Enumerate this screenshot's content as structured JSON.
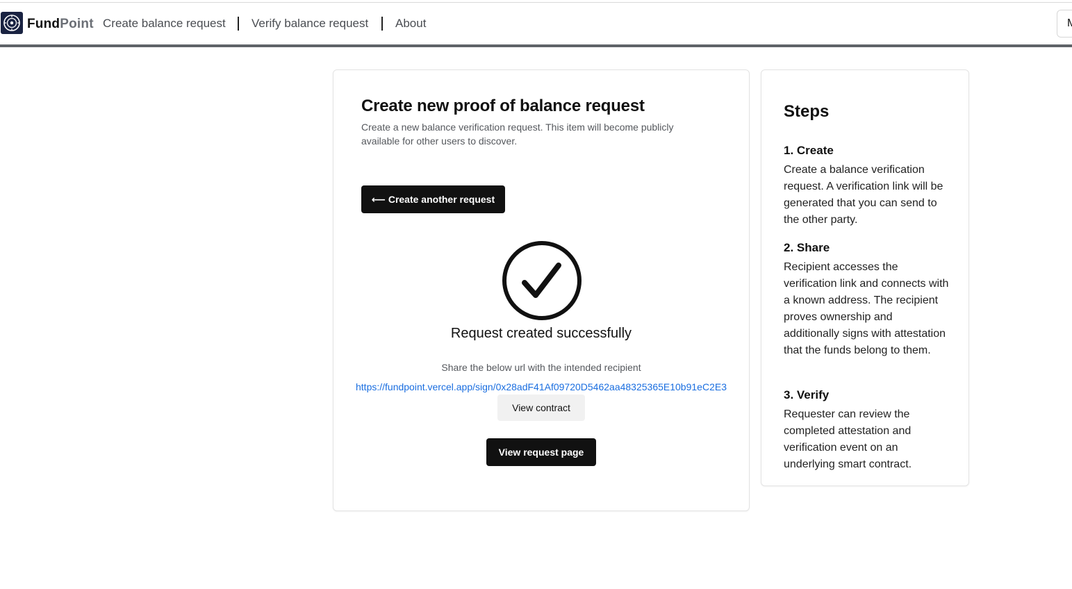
{
  "app": {
    "brand_part1": "Fund",
    "brand_part2": "Point",
    "logo_icon": "fundpoint-logo-icon"
  },
  "nav": {
    "links": [
      "Create balance request",
      "Verify balance request",
      "About"
    ],
    "right_button_label": "M"
  },
  "main": {
    "title": "Create new proof of balance request",
    "description": "Create a new balance verification request. This item will become publicly available for other users to discover.",
    "back_button": "⟵ Create another request",
    "status_icon": "check-circle-icon",
    "success_message": "Request created successfully",
    "share_hint": "Share the below url with the intended recipient",
    "share_url": "https://fundpoint.vercel.app/sign/0x28adF41Af09720D5462aa48325365E10b91eC2E3",
    "view_contract": "View contract",
    "view_request_page": "View request page"
  },
  "steps": {
    "title": "Steps",
    "items": [
      {
        "heading": "1. Create",
        "body": "Create a balance verification request. A verification link will be generated that you can send to the other party."
      },
      {
        "heading": "2. Share",
        "body": "Recipient accesses the verification link and connects with a known address. The recipient proves ownership and additionally signs with attestation that the funds belong to them."
      },
      {
        "heading": "3. Verify",
        "body": "Requester can review the completed attestation and verification event on an underlying smart contract."
      }
    ]
  },
  "colors": {
    "primary_button": "#111111",
    "link": "#1a6ee0",
    "logo_bg": "#1a2342"
  }
}
